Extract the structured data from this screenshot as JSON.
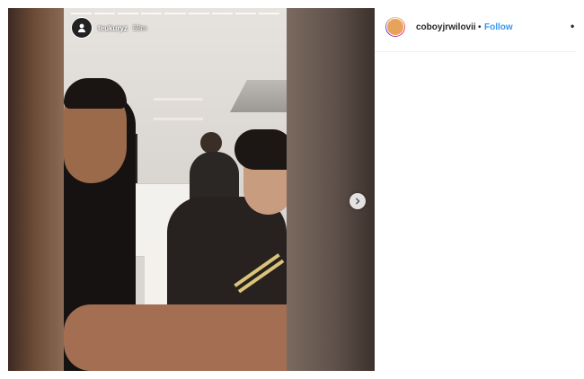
{
  "story": {
    "username": "teukuryz",
    "time": "58m",
    "progress_segments": 9
  },
  "post": {
    "username": "coboyjrwilovii",
    "separator": "•",
    "follow_label": "Follow",
    "more_label": "•"
  },
  "icons": {
    "next": "chevron-right-icon",
    "avatar": "profile-avatar",
    "more": "more-options-icon"
  },
  "colors": {
    "follow": "#3897f0",
    "text": "#262626"
  }
}
